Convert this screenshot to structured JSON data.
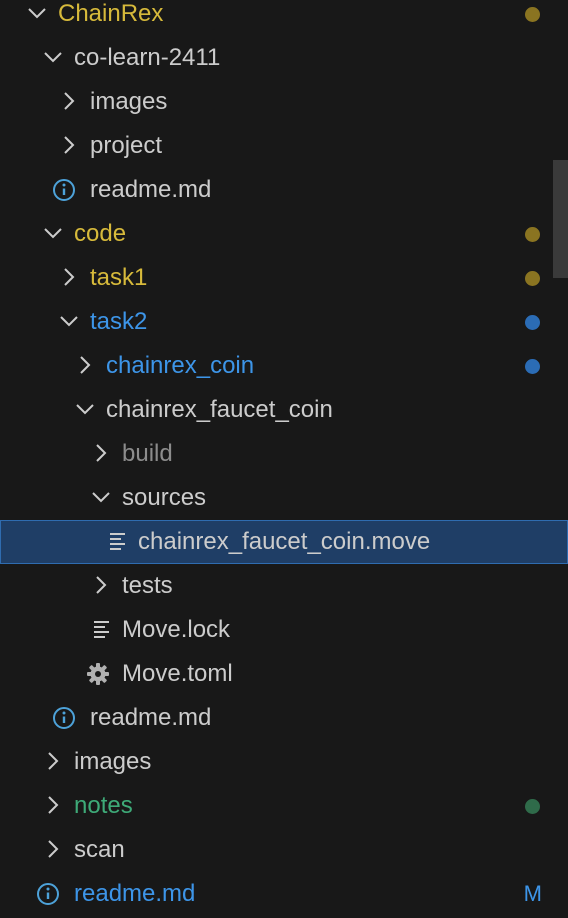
{
  "colors": {
    "default_text": "#cccccc",
    "modified": "#d7ba3b",
    "modified_dot": "#8a7421",
    "link_blue": "#3d95e8",
    "blue_dot": "#2b6cb5",
    "green": "#3eaa78",
    "green_dot": "#2f6b4a",
    "muted": "#8c8c8c",
    "info_icon": "#4da2d9",
    "chevron": "#cccccc",
    "selected_bg": "#1f3e66"
  },
  "tree": [
    {
      "label": "ChainRex",
      "kind": "folder-open",
      "name": "chainrex"
    },
    {
      "label": "co-learn-2411",
      "kind": "folder-open",
      "name": "co-learn-2411"
    },
    {
      "label": "images",
      "kind": "folder-closed",
      "name": "images-1"
    },
    {
      "label": "project",
      "kind": "folder-closed",
      "name": "project"
    },
    {
      "label": "readme.md",
      "kind": "file-info",
      "name": "readme-1"
    },
    {
      "label": "code",
      "kind": "folder-open",
      "name": "code"
    },
    {
      "label": "task1",
      "kind": "folder-closed",
      "name": "task1"
    },
    {
      "label": "task2",
      "kind": "folder-open",
      "name": "task2"
    },
    {
      "label": "chainrex_coin",
      "kind": "folder-closed",
      "name": "chainrex-coin"
    },
    {
      "label": "chainrex_faucet_coin",
      "kind": "folder-open",
      "name": "chainrex-faucet-coin"
    },
    {
      "label": "build",
      "kind": "folder-closed",
      "name": "build"
    },
    {
      "label": "sources",
      "kind": "folder-open",
      "name": "sources"
    },
    {
      "label": "chainrex_faucet_coin.move",
      "kind": "file-text",
      "name": "chainrex-faucet-coin-move"
    },
    {
      "label": "tests",
      "kind": "folder-closed",
      "name": "tests"
    },
    {
      "label": "Move.lock",
      "kind": "file-text",
      "name": "move-lock"
    },
    {
      "label": "Move.toml",
      "kind": "file-gear",
      "name": "move-toml"
    },
    {
      "label": "readme.md",
      "kind": "file-info",
      "name": "readme-2"
    },
    {
      "label": "images",
      "kind": "folder-closed",
      "name": "images-2"
    },
    {
      "label": "notes",
      "kind": "folder-closed",
      "name": "notes"
    },
    {
      "label": "scan",
      "kind": "folder-closed",
      "name": "scan"
    },
    {
      "label": "readme.md",
      "kind": "file-info",
      "name": "readme-3"
    }
  ],
  "badges": {
    "readme_root": "M"
  }
}
